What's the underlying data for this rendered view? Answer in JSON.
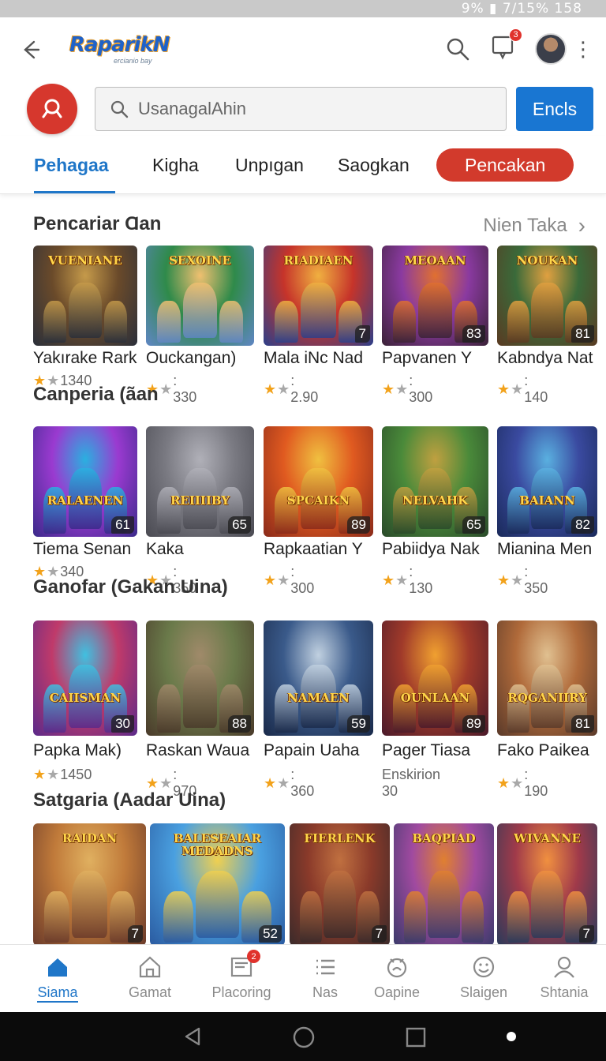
{
  "status_bar": {
    "text": "9% ▮ 7/15% 158"
  },
  "header": {
    "logo_text": "RaparikN",
    "logo_sub": "ercianio bay",
    "notification_count": "3"
  },
  "search": {
    "placeholder": "UsanagalAhin",
    "button_label": "Encls"
  },
  "tabs": [
    {
      "label": "Pehagaa",
      "active": true
    },
    {
      "label": "Kigha"
    },
    {
      "label": "Unpıgan"
    },
    {
      "label": "Saogkan"
    },
    {
      "label": "Pencakan",
      "highlight": true
    }
  ],
  "sections": [
    {
      "title": "Pencariar Ɑan",
      "see_more": "Nien Taka",
      "cards": [
        {
          "name": "Yakırake Rark",
          "rating": "1340",
          "badge": "",
          "art_title": "VUENIANE",
          "colors": [
            "#2a2f3a",
            "#6a4a2a",
            "#c59a4a"
          ]
        },
        {
          "name": "Ouckangan)",
          "rating": ": 330",
          "badge": "",
          "art_title": "SEXOINE",
          "colors": [
            "#5f86c4",
            "#2f8a4a",
            "#f0c070"
          ]
        },
        {
          "name": "Mala iNc Nad",
          "rating": ": 2.90",
          "badge": "7",
          "art_title": "RIADIAEN",
          "colors": [
            "#2c3f8a",
            "#c6342a",
            "#f0b040"
          ]
        },
        {
          "name": "Papvanen Y",
          "rating": ": 300",
          "badge": "83",
          "art_title": "MEOAAN",
          "colors": [
            "#3a2236",
            "#8a3aa0",
            "#e07030"
          ]
        },
        {
          "name": "Kabndya Nat",
          "rating": ": 140",
          "badge": "81",
          "art_title": "NOUKAN",
          "colors": [
            "#5a3a22",
            "#3a6a3a",
            "#e0a040"
          ]
        }
      ]
    },
    {
      "title": "Canperia (ãan",
      "see_more": "",
      "cards": [
        {
          "name": "Tiema Senan",
          "rating": "340",
          "badge": "61",
          "art_title": "RALAENEN",
          "colors": [
            "#3a2a8a",
            "#9a3ad0",
            "#2ab0e0"
          ]
        },
        {
          "name": "Kaka",
          "rating": ": 350",
          "badge": "65",
          "art_title": "REIIIIBY",
          "colors": [
            "#4a4a52",
            "#7a7a82",
            "#b0b0b8"
          ]
        },
        {
          "name": "Rapkaatian Y",
          "rating": ": 300",
          "badge": "89",
          "art_title": "SPCAIKN",
          "colors": [
            "#8a2a1a",
            "#e05a20",
            "#f0c040"
          ]
        },
        {
          "name": "Pabiidya Nak",
          "rating": ": 130",
          "badge": "65",
          "art_title": "NELVAHK",
          "colors": [
            "#2a4a2a",
            "#4a8a3a",
            "#c0a040"
          ]
        },
        {
          "name": "Mianina Men",
          "rating": ": 350",
          "badge": "82",
          "art_title": "BAIANN",
          "colors": [
            "#1a2a5a",
            "#3a4aa0",
            "#5ab0e0"
          ]
        }
      ]
    },
    {
      "title": "Ganofar (Gakan Uina)",
      "see_more": "",
      "cards": [
        {
          "name": "Papka Mak)",
          "rating": "1450",
          "badge": "30",
          "art_title": "CAIISMAN",
          "colors": [
            "#5a2a8a",
            "#c03a6a",
            "#40c0e0"
          ]
        },
        {
          "name": "Raskan Waua",
          "rating": ": 970",
          "badge": "88",
          "art_title": "",
          "colors": [
            "#4a3a2a",
            "#6a7a4a",
            "#a08a6a"
          ]
        },
        {
          "name": "Papain Uaha",
          "rating": ": 360",
          "badge": "59",
          "art_title": "NAMAEN",
          "colors": [
            "#1a2a4a",
            "#3a5a8a",
            "#c0d0e0"
          ]
        },
        {
          "name": "Pager Tiasa",
          "rating": "Enskirion 30",
          "badge": "89",
          "art_title": "OUNLAAN",
          "colors": [
            "#4a1a2a",
            "#a03a2a",
            "#f0a030"
          ]
        },
        {
          "name": "Fako Paikea",
          "rating": ": 190",
          "badge": "81",
          "art_title": "RQGANIIRY",
          "colors": [
            "#5a3a2a",
            "#b06a3a",
            "#e0c090"
          ]
        }
      ]
    },
    {
      "title": "Satgaria (Aadar Uina)",
      "see_more": "",
      "cards": [
        {
          "name": "",
          "rating": "",
          "badge": "7",
          "art_title": "RAIDAN",
          "colors": [
            "#6a3a2a",
            "#c07a3a",
            "#e0b060"
          ]
        },
        {
          "name": "",
          "rating": "",
          "badge": "52",
          "art_title": "BALESEAIAR MEDADNS",
          "colors": [
            "#2a5aa0",
            "#4aa0e0",
            "#f0d050"
          ]
        },
        {
          "name": "",
          "rating": "",
          "badge": "7",
          "art_title": "FIERLENK",
          "colors": [
            "#3a2a2a",
            "#8a3a2a",
            "#c07040"
          ]
        },
        {
          "name": "",
          "rating": "",
          "badge": "",
          "art_title": "BAQPIAD",
          "colors": [
            "#3a3a6a",
            "#a04aa0",
            "#e08030"
          ]
        },
        {
          "name": "",
          "rating": "",
          "badge": "7",
          "art_title": "WIVANNE",
          "colors": [
            "#2a3a5a",
            "#a03a4a",
            "#f09040"
          ]
        }
      ]
    }
  ],
  "bottom_nav": [
    {
      "label": "Siama",
      "icon": "home-icon",
      "active": true
    },
    {
      "label": "Gamat",
      "icon": "house-outline-icon"
    },
    {
      "label": "Placoring",
      "icon": "inbox-icon",
      "badge": "2"
    },
    {
      "label": "Nas",
      "icon": "list-icon"
    },
    {
      "label": "Oapine",
      "icon": "face-icon"
    },
    {
      "label": "Slaigen",
      "icon": "smile-icon"
    },
    {
      "label": "Shtania",
      "icon": "person-icon"
    }
  ]
}
